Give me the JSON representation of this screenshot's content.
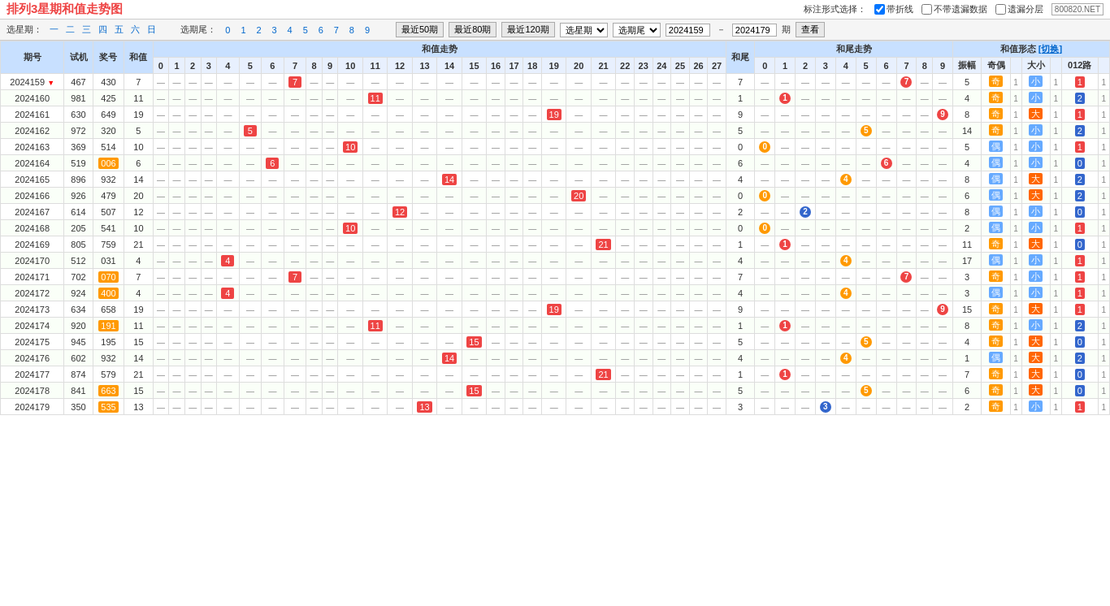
{
  "header": {
    "title": "排列3星期和值走势图",
    "watermark": "800820.NET",
    "label_style": "标注形式选择：",
    "option_with_fold": "带折线",
    "option_no_missing": "不带遗漏数据",
    "option_missing_layer": "遗漏分层"
  },
  "filter": {
    "label_week": "选星期：",
    "weeks": [
      "一",
      "二",
      "三",
      "四",
      "五",
      "六",
      "日"
    ],
    "label_tail": "选期尾：",
    "tails": [
      "0",
      "1",
      "2",
      "3",
      "4",
      "5",
      "6",
      "7",
      "8",
      "9"
    ],
    "btn_recent50": "最近50期",
    "btn_recent80": "最近80期",
    "btn_recent120": "最近120期",
    "label_select_week": "选星期",
    "label_select_tail": "选期尾",
    "period_from": "2024159",
    "period_to": "2024179",
    "label_period": "期",
    "btn_view": "查看"
  },
  "table": {
    "col_groups": [
      {
        "label": "期号",
        "span": 1
      },
      {
        "label": "试机",
        "span": 1
      },
      {
        "label": "奖号",
        "span": 1
      },
      {
        "label": "和值",
        "span": 1
      },
      {
        "label": "和值走势",
        "span": 28
      },
      {
        "label": "和尾",
        "span": 1
      },
      {
        "label": "和尾走势",
        "span": 10
      },
      {
        "label": "振幅",
        "span": 1
      },
      {
        "label": "和值形态 [切换]",
        "span": 6
      }
    ],
    "hz_headers": [
      "0",
      "1",
      "2",
      "3",
      "4",
      "5",
      "6",
      "7",
      "8",
      "9",
      "10",
      "11",
      "12",
      "13",
      "14",
      "15",
      "16",
      "17",
      "18",
      "19",
      "20",
      "21",
      "22",
      "23",
      "24",
      "25",
      "26",
      "27"
    ],
    "hwei_headers": [
      "0",
      "1",
      "2",
      "3",
      "4",
      "5",
      "6",
      "7",
      "8",
      "9"
    ],
    "form_headers": [
      "振幅",
      "奇偶",
      "",
      "大小",
      "",
      "012路",
      ""
    ],
    "rows": [
      {
        "qihao": "2024159",
        "shiji": "467",
        "jianghao": "430",
        "hezhi": "7",
        "hwei": "7",
        "zhenfu": "5",
        "jioou": "奇",
        "da_xiao": "小",
        "lu": "1"
      },
      {
        "qihao": "2024160",
        "shiji": "981",
        "jianghao": "425",
        "hezhi": "11",
        "hwei": "1",
        "zhenfu": "4",
        "jioou": "奇",
        "da_xiao": "小",
        "lu": "2"
      },
      {
        "qihao": "2024161",
        "shiji": "630",
        "jianghao": "649",
        "hezhi": "19",
        "hwei": "9",
        "zhenfu": "8",
        "jioou": "奇",
        "da_xiao": "大",
        "lu": "1"
      },
      {
        "qihao": "2024162",
        "shiji": "972",
        "jianghao": "320",
        "hezhi": "5",
        "hwei": "5",
        "zhenfu": "14",
        "jioou": "奇",
        "da_xiao": "小",
        "lu": "2"
      },
      {
        "qihao": "2024163",
        "shiji": "369",
        "jianghao": "514",
        "hezhi": "10",
        "hwei": "0",
        "zhenfu": "5",
        "jioou": "偶",
        "da_xiao": "小",
        "lu": "1"
      },
      {
        "qihao": "2024164",
        "shiji": "519",
        "jianghao": "006",
        "hezhi": "6",
        "hwei": "6",
        "zhenfu": "4",
        "jioou": "偶",
        "da_xiao": "小",
        "lu": "0"
      },
      {
        "qihao": "2024165",
        "shiji": "896",
        "jianghao": "932",
        "hezhi": "14",
        "hwei": "4",
        "zhenfu": "8",
        "jioou": "偶",
        "da_xiao": "大",
        "lu": "2"
      },
      {
        "qihao": "2024166",
        "shiji": "926",
        "jianghao": "479",
        "hezhi": "20",
        "hwei": "0",
        "zhenfu": "6",
        "jioou": "偶",
        "da_xiao": "大",
        "lu": "2"
      },
      {
        "qihao": "2024167",
        "shiji": "614",
        "jianghao": "507",
        "hezhi": "12",
        "hwei": "2",
        "zhenfu": "8",
        "jioou": "偶",
        "da_xiao": "小",
        "lu": "0"
      },
      {
        "qihao": "2024168",
        "shiji": "205",
        "jianghao": "541",
        "hezhi": "10",
        "hwei": "0",
        "zhenfu": "2",
        "jioou": "偶",
        "da_xiao": "小",
        "lu": "1"
      },
      {
        "qihao": "2024169",
        "shiji": "805",
        "jianghao": "759",
        "hezhi": "21",
        "hwei": "1",
        "zhenfu": "11",
        "jioou": "奇",
        "da_xiao": "大",
        "lu": "0"
      },
      {
        "qihao": "2024170",
        "shiji": "512",
        "jianghao": "031",
        "hezhi": "4",
        "hwei": "4",
        "zhenfu": "17",
        "jioou": "偶",
        "da_xiao": "小",
        "lu": "1"
      },
      {
        "qihao": "2024171",
        "shiji": "702",
        "jianghao": "070",
        "hezhi": "7",
        "hwei": "7",
        "zhenfu": "3",
        "jioou": "奇",
        "da_xiao": "小",
        "lu": "1"
      },
      {
        "qihao": "2024172",
        "shiji": "924",
        "jianghao": "400",
        "hezhi": "4",
        "hwei": "4",
        "zhenfu": "3",
        "jioou": "偶",
        "da_xiao": "小",
        "lu": "1"
      },
      {
        "qihao": "2024173",
        "shiji": "634",
        "jianghao": "658",
        "hezhi": "19",
        "hwei": "9",
        "zhenfu": "15",
        "jioou": "奇",
        "da_xiao": "大",
        "lu": "1"
      },
      {
        "qihao": "2024174",
        "shiji": "920",
        "jianghao": "191",
        "hezhi": "11",
        "hwei": "1",
        "zhenfu": "8",
        "jioou": "奇",
        "da_xiao": "小",
        "lu": "2"
      },
      {
        "qihao": "2024175",
        "shiji": "945",
        "jianghao": "195",
        "hezhi": "15",
        "hwei": "5",
        "zhenfu": "4",
        "jioou": "奇",
        "da_xiao": "大",
        "lu": "0"
      },
      {
        "qihao": "2024176",
        "shiji": "602",
        "jianghao": "932",
        "hezhi": "14",
        "hwei": "4",
        "zhenfu": "1",
        "jioou": "偶",
        "da_xiao": "大",
        "lu": "2"
      },
      {
        "qihao": "2024177",
        "shiji": "874",
        "jianghao": "579",
        "hezhi": "21",
        "hwei": "1",
        "zhenfu": "7",
        "jioou": "奇",
        "da_xiao": "大",
        "lu": "0"
      },
      {
        "qihao": "2024178",
        "shiji": "841",
        "jianghao": "663",
        "hezhi": "15",
        "hwei": "5",
        "zhenfu": "6",
        "jioou": "奇",
        "da_xiao": "大",
        "lu": "0"
      },
      {
        "qihao": "2024179",
        "shiji": "350",
        "jianghao": "535",
        "hezhi": "13",
        "hwei": "3",
        "zhenfu": "2",
        "jioou": "奇",
        "da_xiao": "小",
        "lu": "1"
      }
    ]
  }
}
